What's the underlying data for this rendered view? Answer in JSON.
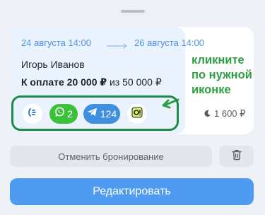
{
  "booking": {
    "date_from": "24 августа 14:00",
    "date_to": "26 августа 14:00",
    "guest_name": "Игорь Иванов",
    "payment_due": "К оплате 20 000 ₽",
    "payment_total": "из 50 000 ₽",
    "price": "1 600 ₽"
  },
  "channels": [
    {
      "name": "booking-icon"
    },
    {
      "name": "whatsapp-icon",
      "count": "2",
      "color": "#3ec13a"
    },
    {
      "name": "telegram-icon",
      "count": "124",
      "color": "#3f8fe0"
    },
    {
      "name": "ostrovok-icon"
    }
  ],
  "hint": {
    "line1": "кликните",
    "line2": "по нужной",
    "line3": "иконке",
    "color": "#2ea043"
  },
  "actions": {
    "cancel_label": "Отменить бронирование",
    "edit_label": "Редактировать"
  },
  "colors": {
    "accent": "#4e9bf1",
    "frame": "#1e8a4a",
    "date": "#4c93e6"
  }
}
